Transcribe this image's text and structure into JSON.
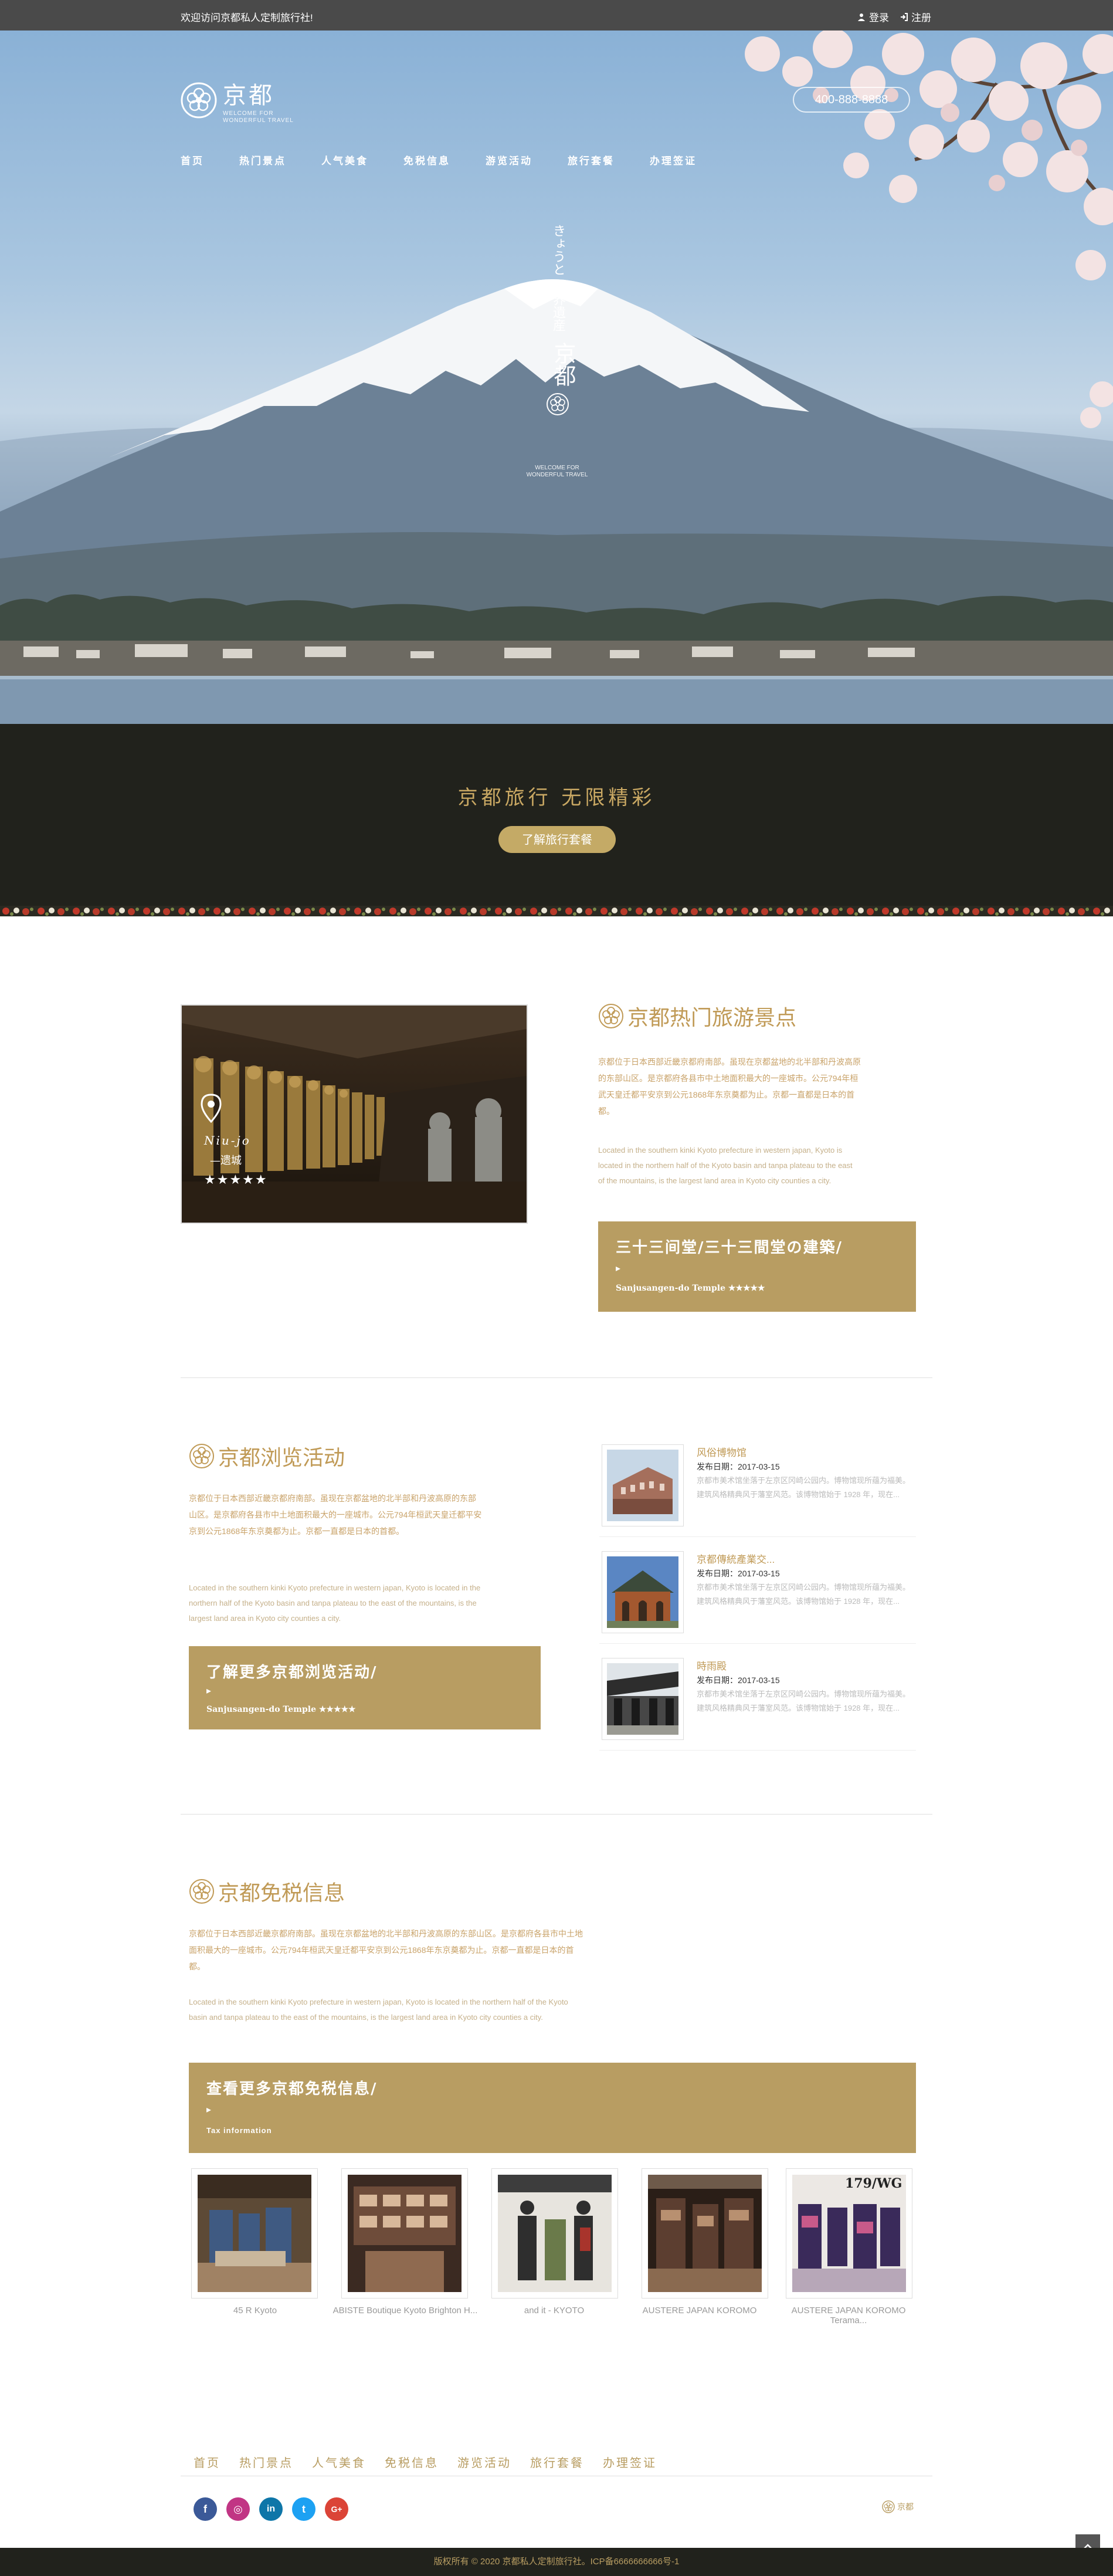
{
  "topbar": {
    "welcome": "欢迎访问京都私人定制旅行社!",
    "login": "登录",
    "register": "注册"
  },
  "brand": {
    "name": "京都",
    "sub1": "WELCOME FOR",
    "sub2": "WONDERFUL TRAVEL",
    "phone": "400-888-8888"
  },
  "nav": [
    "首页",
    "热门景点",
    "人气美食",
    "免税信息",
    "游览活动",
    "旅行套餐",
    "办理签证"
  ],
  "hero": {
    "vertical_1": "きょうと 世界遺産",
    "vertical_2": "京都",
    "small_1": "WELCOME FOR",
    "small_2": "WONDERFUL TRAVEL"
  },
  "band": {
    "title": "京都旅行 无限精彩",
    "button": "了解旅行套餐"
  },
  "spots": {
    "photo_caption_1": "Niu-jo",
    "photo_caption_2": "—遗城",
    "photo_stars": "★★★★★",
    "title": "京都热门旅游景点",
    "zh": "京都位于日本西部近畿京都府南部。虽现在京都盆地的北半部和丹波高原的东部山区。是京都府各县市中土地面积最大的一座城市。公元794年桓武天皇迁都平安京到公元1868年东京奠都为止。京都一直都是日本的首都。",
    "en": "Located in the southern kinki Kyoto prefecture in western japan, Kyoto is located in the northern half of the Kyoto basin and tanpa plateau to the east of the mountains, is the largest land area in Kyoto city counties a city.",
    "box_title": "三十三间堂/三十三間堂の建築/",
    "box_arrow": "▸",
    "box_sub": "Sanjusangen-do Temple ★★★★★"
  },
  "activities": {
    "title": "京都浏览活动",
    "zh": "京都位于日本西部近畿京都府南部。虽现在京都盆地的北半部和丹波高原的东部山区。是京都府各县市中土地面积最大的一座城市。公元794年桓武天皇迁都平安京到公元1868年东京奠都为止。京都一直都是日本的首都。",
    "en": "Located in the southern kinki Kyoto prefecture in western japan, Kyoto is located in the northern half of the Kyoto basin and tanpa plateau to the east of the mountains, is the largest land area in Kyoto city counties a city.",
    "box_title": "了解更多京都浏览活动/",
    "box_arrow": "▸",
    "box_sub": "Sanjusangen-do Temple ★★★★★",
    "news": [
      {
        "title": "风俗博物馆",
        "date": "发布日期：2017-03-15",
        "text": "京都市美术馆坐落于左京区冈崎公园内。博物馆现所蕴为福美。建筑风格精典风于藩室风范。该博物馆始于 1928 年，现在..."
      },
      {
        "title": "京都傳統產業交...",
        "date": "发布日期：2017-03-15",
        "text": "京都市美术馆坐落于左京区冈崎公园内。博物馆现所蕴为福美。建筑风格精典风于藩室风范。该博物馆始于 1928 年，现在..."
      },
      {
        "title": "時雨殿",
        "date": "发布日期：2017-03-15",
        "text": "京都市美术馆坐落于左京区冈崎公园内。博物馆现所蕴为福美。建筑风格精典风于藩室风范。该博物馆始于 1928 年，现在..."
      }
    ]
  },
  "dutyfree": {
    "title": "京都免税信息",
    "zh": "京都位于日本西部近畿京都府南部。虽现在京都盆地的北半部和丹波高原的东部山区。是京都府各县市中土地面积最大的一座城市。公元794年桓武天皇迁都平安京到公元1868年东京奠都为止。京都一直都是日本的首都。",
    "en": "Located in the southern kinki Kyoto prefecture in western japan, Kyoto is located in the northern half of the Kyoto basin and tanpa plateau to the east of the mountains, is the largest land area in Kyoto city counties a city.",
    "box_title": "查看更多京都免税信息/",
    "box_arrow": "▸",
    "box_sub": "Tax information",
    "shops": [
      "45 R Kyoto",
      "ABISTE Boutique Kyoto Brighton H...",
      "and it - KYOTO",
      "AUSTERE JAPAN KOROMO",
      "AUSTERE JAPAN KOROMO Terama..."
    ],
    "shop5_sign": "179/WG"
  },
  "footer": {
    "nav": [
      "首页",
      "热门景点",
      "人气美食",
      "免税信息",
      "游览活动",
      "旅行套餐",
      "办理签证"
    ],
    "logo": "京都",
    "copyright": "版权所有 © 2020 京都私人定制旅行社。ICP备6666666666号-1",
    "social": [
      "f",
      "◎",
      "in",
      "t",
      "G+"
    ]
  },
  "colors": {
    "gold": "#b89d62",
    "dark": "#21221c",
    "topbar": "#4a4a4a"
  }
}
